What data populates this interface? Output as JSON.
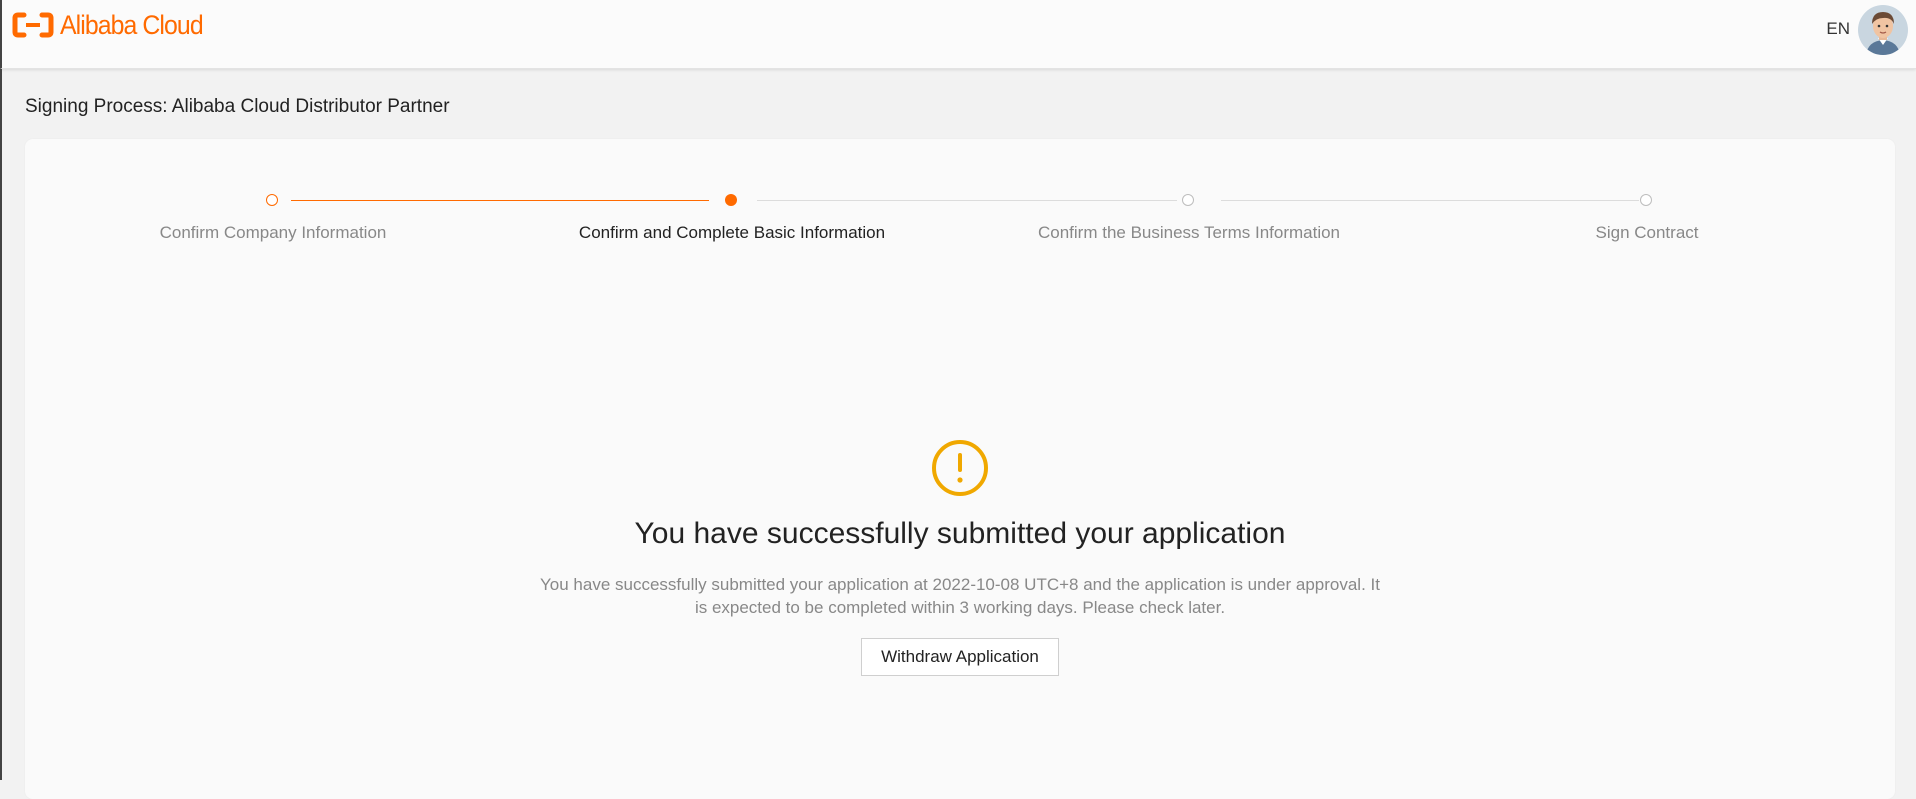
{
  "header": {
    "logo_text": "Alibaba Cloud",
    "language": "EN",
    "brand_color": "#ff6a00"
  },
  "page": {
    "title": "Signing Process: Alibaba Cloud Distributor Partner"
  },
  "steps": [
    {
      "label": "Confirm Company Information",
      "status": "done"
    },
    {
      "label": "Confirm and Complete Basic Information",
      "status": "current"
    },
    {
      "label": "Confirm the Business Terms Information",
      "status": "pending"
    },
    {
      "label": "Sign Contract",
      "status": "pending"
    }
  ],
  "result": {
    "icon": "exclamation-circle-icon",
    "icon_color": "#f0a800",
    "title": "You have successfully submitted your application",
    "description_line1": "You have successfully submitted your application at 2022-10-08 UTC+8 and the application is under approval. It",
    "description_line2": "is expected to be completed within 3 working days. Please check later.",
    "button_label": "Withdraw Application"
  }
}
